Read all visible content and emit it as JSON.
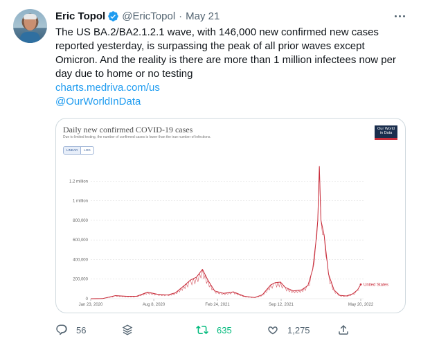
{
  "tweet": {
    "author_name": "Eric Topol",
    "handle": "@EricTopol",
    "separator": "·",
    "date": "May 21",
    "text": "The US BA.2/BA2.1.2.1 wave, with 146,000 new confirmed new cases reported yesterday, is surpassing the peak of all prior waves except Omicron. And the reality is there are more than 1 million infectees now per day due to home or no testing",
    "link_1": "charts.medriva.com/us",
    "link_2": "@OurWorldInData"
  },
  "actions": {
    "reply_count": "56",
    "retweet_count": "635",
    "like_count": "1,275"
  },
  "icons": {
    "verified": "verified-badge-icon",
    "more": "more-horizontal-icon",
    "reply": "reply-bubble-icon",
    "stack": "stack-icon",
    "retweet": "retweet-icon",
    "like": "heart-icon",
    "share": "share-icon"
  },
  "colors": {
    "accent": "#1d9bf0",
    "retweet_active": "#00ba7c",
    "series": "#c82d3b",
    "owid_navy": "#1a2e4d"
  },
  "chart_data": {
    "type": "line",
    "title": "Daily new confirmed COVID-19 cases",
    "subtitle": "Due to limited testing, the number of confirmed cases is lower than the true number of infections.",
    "brand": "Our World in Data",
    "scale_options": [
      "LINEAR",
      "LOG"
    ],
    "selected_scale": "LINEAR",
    "xticks": [
      "Jan 23, 2020",
      "Aug 8, 2020",
      "Feb 24, 2021",
      "Sep 12, 2021",
      "May 20, 2022"
    ],
    "yticks": [
      "0",
      "200,000",
      "400,000",
      "600,000",
      "800,000",
      "1 million",
      "1.2 million"
    ],
    "ylim": [
      0,
      1400000
    ],
    "grid": "horizontal dashed",
    "legend_position": "right end label",
    "series": [
      {
        "name": "United States",
        "x": [
          "2020-01-23",
          "2020-03-01",
          "2020-04-10",
          "2020-05-15",
          "2020-06-15",
          "2020-07-20",
          "2020-08-20",
          "2020-09-20",
          "2020-10-15",
          "2020-11-10",
          "2020-12-01",
          "2020-12-20",
          "2021-01-08",
          "2021-01-25",
          "2021-02-15",
          "2021-03-15",
          "2021-04-15",
          "2021-05-20",
          "2021-06-20",
          "2021-07-15",
          "2021-08-10",
          "2021-08-25",
          "2021-09-10",
          "2021-09-25",
          "2021-10-20",
          "2021-11-15",
          "2021-12-05",
          "2021-12-20",
          "2021-12-30",
          "2022-01-05",
          "2022-01-10",
          "2022-01-15",
          "2022-01-25",
          "2022-02-08",
          "2022-02-25",
          "2022-03-15",
          "2022-04-05",
          "2022-04-25",
          "2022-05-10",
          "2022-05-20"
        ],
        "values": [
          0,
          2000,
          32000,
          25000,
          25000,
          67000,
          45000,
          38000,
          60000,
          130000,
          190000,
          220000,
          300000,
          190000,
          80000,
          55000,
          70000,
          25000,
          12000,
          40000,
          140000,
          165000,
          170000,
          115000,
          80000,
          90000,
          135000,
          300000,
          580000,
          800000,
          1350000,
          800000,
          650000,
          250000,
          90000,
          35000,
          28000,
          50000,
          90000,
          146000
        ]
      }
    ]
  }
}
